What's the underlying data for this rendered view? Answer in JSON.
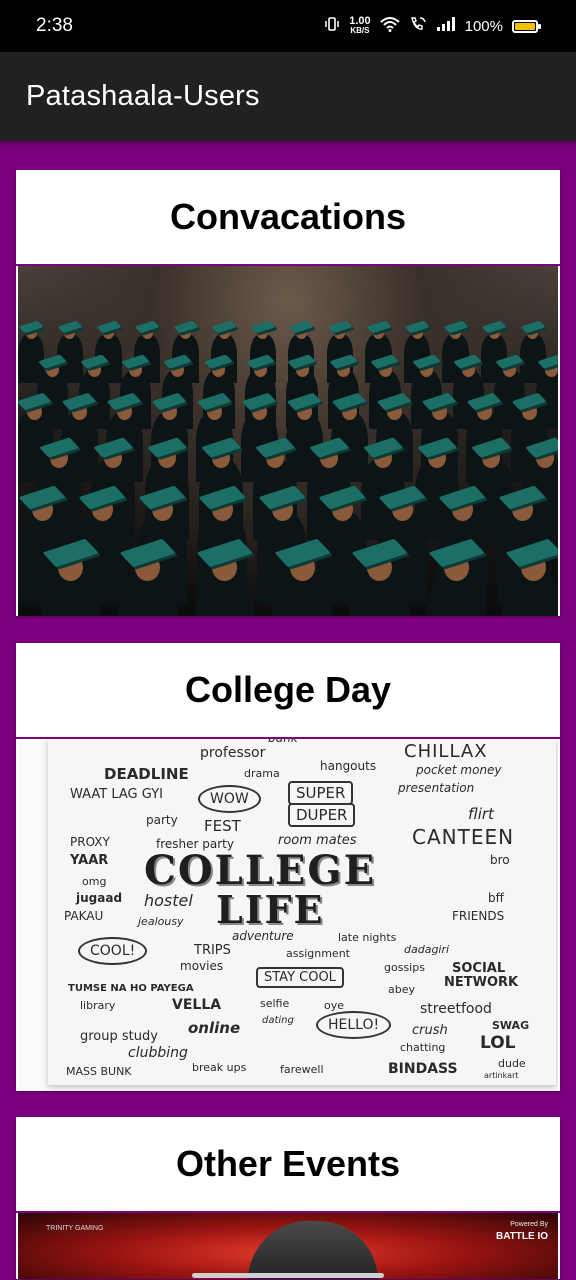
{
  "status_bar": {
    "time": "2:38",
    "net_speed_value": "1.00",
    "net_speed_unit": "KB/S",
    "battery_percent": "100%",
    "battery_level": 1.0,
    "icons": [
      "vibrate-icon",
      "wifi-icon",
      "wifi-calling-icon",
      "signal-icon",
      "battery-icon"
    ]
  },
  "app_bar": {
    "title": "Patashaala-Users"
  },
  "cards": [
    {
      "title": "Convacations"
    },
    {
      "title": "College Day"
    },
    {
      "title": "Other Events"
    }
  ],
  "college_poster": {
    "words": [
      "bunk",
      "professor",
      "CHILLAX",
      "DEADLINE",
      "drama",
      "hangouts",
      "pocket money",
      "WAAT LAG GYI",
      "WOW",
      "SUPER",
      "DUPER",
      "presentation",
      "party",
      "FEST",
      "flirt",
      "PROXY",
      "fresher party",
      "room mates",
      "CANTEEN",
      "YAAR",
      "bro",
      "omg",
      "COLLEGE",
      "jugaad",
      "hostel",
      "LIFE",
      "bff",
      "PAKAU",
      "jealousy",
      "FRIENDS",
      "adventure",
      "late nights",
      "COOL!",
      "TRIPS",
      "assignment",
      "dadagiri",
      "movies",
      "STAY COOL",
      "gossips",
      "SOCIAL",
      "NETWORK",
      "TUMSE NA HO PAYEGA",
      "abey",
      "library",
      "VELLA",
      "selfie",
      "oye",
      "streetfood",
      "dating",
      "online",
      "HELLO!",
      "group study",
      "crush",
      "SWAG",
      "clubbing",
      "chatting",
      "LOL",
      "MASS BUNK",
      "break ups",
      "farewell",
      "BINDASS",
      "dude",
      "artinkart"
    ]
  },
  "events_image": {
    "left_logo": "TRINITY GAMING",
    "right_top": "Powered By",
    "right_brand": "BATTLE IO"
  }
}
